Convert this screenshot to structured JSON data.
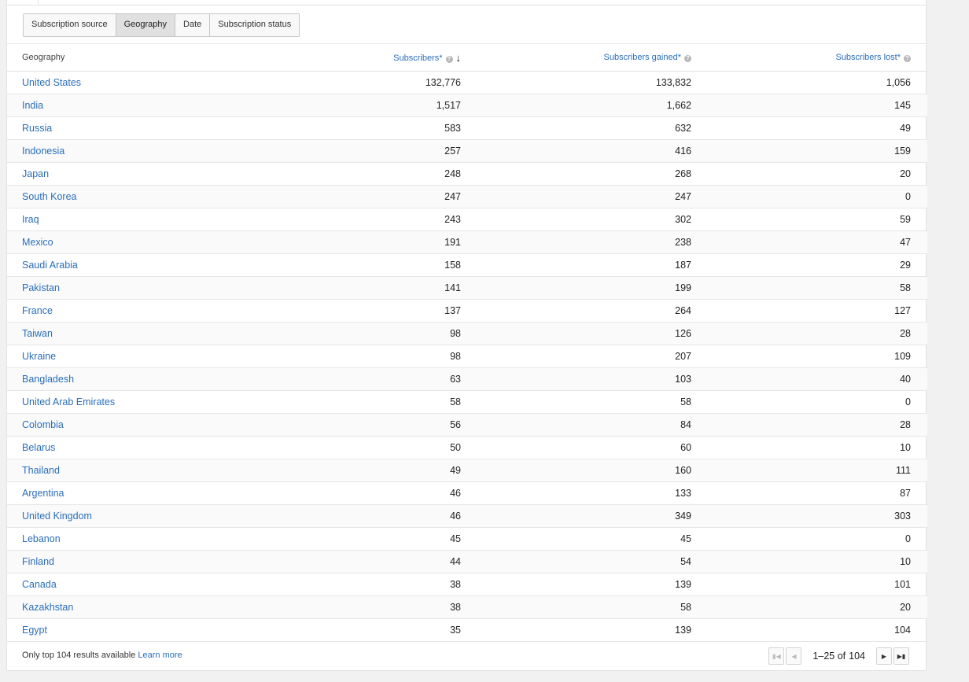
{
  "tabs": {
    "items": [
      {
        "label": "Subscription source",
        "active": false
      },
      {
        "label": "Geography",
        "active": true
      },
      {
        "label": "Date",
        "active": false
      },
      {
        "label": "Subscription status",
        "active": false
      }
    ]
  },
  "table": {
    "headers": {
      "geography": "Geography",
      "subscribers": "Subscribers*",
      "gained": "Subscribers gained*",
      "lost": "Subscribers lost*"
    },
    "sort_icon": "arrow-down-icon",
    "help_icon": "question-circle-icon",
    "rows": [
      {
        "geo": "United States",
        "subs": "132,776",
        "gained": "133,832",
        "lost": "1,056"
      },
      {
        "geo": "India",
        "subs": "1,517",
        "gained": "1,662",
        "lost": "145"
      },
      {
        "geo": "Russia",
        "subs": "583",
        "gained": "632",
        "lost": "49"
      },
      {
        "geo": "Indonesia",
        "subs": "257",
        "gained": "416",
        "lost": "159"
      },
      {
        "geo": "Japan",
        "subs": "248",
        "gained": "268",
        "lost": "20"
      },
      {
        "geo": "South Korea",
        "subs": "247",
        "gained": "247",
        "lost": "0"
      },
      {
        "geo": "Iraq",
        "subs": "243",
        "gained": "302",
        "lost": "59"
      },
      {
        "geo": "Mexico",
        "subs": "191",
        "gained": "238",
        "lost": "47"
      },
      {
        "geo": "Saudi Arabia",
        "subs": "158",
        "gained": "187",
        "lost": "29"
      },
      {
        "geo": "Pakistan",
        "subs": "141",
        "gained": "199",
        "lost": "58"
      },
      {
        "geo": "France",
        "subs": "137",
        "gained": "264",
        "lost": "127"
      },
      {
        "geo": "Taiwan",
        "subs": "98",
        "gained": "126",
        "lost": "28"
      },
      {
        "geo": "Ukraine",
        "subs": "98",
        "gained": "207",
        "lost": "109"
      },
      {
        "geo": "Bangladesh",
        "subs": "63",
        "gained": "103",
        "lost": "40"
      },
      {
        "geo": "United Arab Emirates",
        "subs": "58",
        "gained": "58",
        "lost": "0"
      },
      {
        "geo": "Colombia",
        "subs": "56",
        "gained": "84",
        "lost": "28"
      },
      {
        "geo": "Belarus",
        "subs": "50",
        "gained": "60",
        "lost": "10"
      },
      {
        "geo": "Thailand",
        "subs": "49",
        "gained": "160",
        "lost": "111"
      },
      {
        "geo": "Argentina",
        "subs": "46",
        "gained": "133",
        "lost": "87"
      },
      {
        "geo": "United Kingdom",
        "subs": "46",
        "gained": "349",
        "lost": "303"
      },
      {
        "geo": "Lebanon",
        "subs": "45",
        "gained": "45",
        "lost": "0"
      },
      {
        "geo": "Finland",
        "subs": "44",
        "gained": "54",
        "lost": "10"
      },
      {
        "geo": "Canada",
        "subs": "38",
        "gained": "139",
        "lost": "101"
      },
      {
        "geo": "Kazakhstan",
        "subs": "38",
        "gained": "58",
        "lost": "20"
      },
      {
        "geo": "Egypt",
        "subs": "35",
        "gained": "139",
        "lost": "104"
      }
    ]
  },
  "footer": {
    "note": "Only top 104 results available",
    "learn_more": "Learn more"
  },
  "pagination": {
    "range": "1–25 of",
    "total": "104",
    "first_icon": "first-page-icon",
    "prev_icon": "prev-page-icon",
    "next_icon": "next-page-icon",
    "last_icon": "last-page-icon"
  }
}
